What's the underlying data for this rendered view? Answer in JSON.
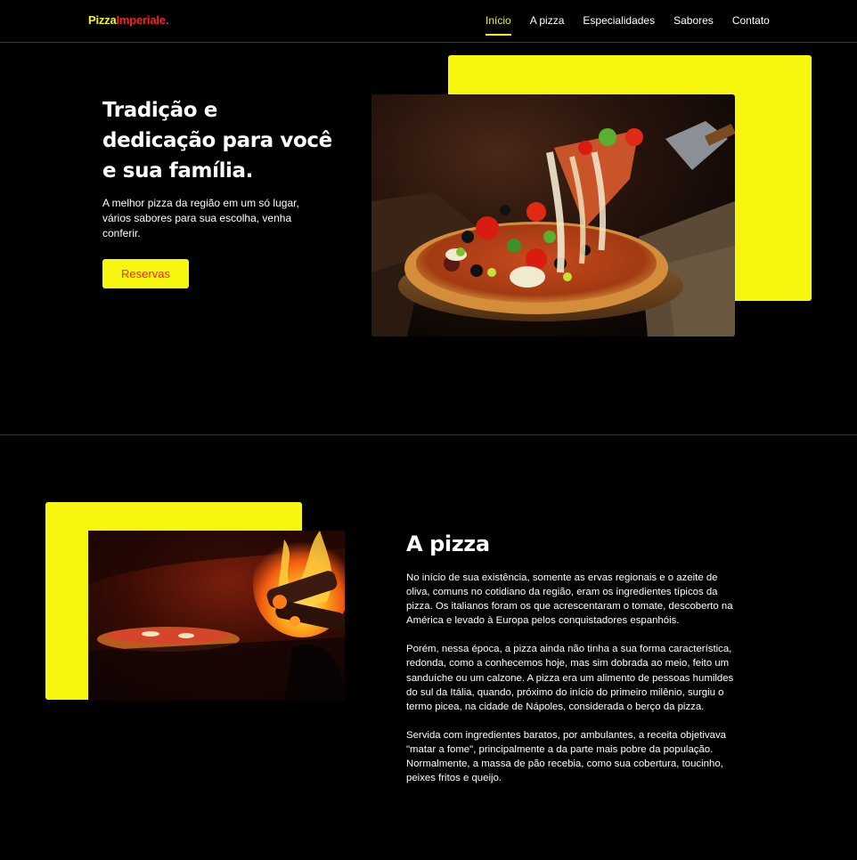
{
  "brand": {
    "part1": "Pizza",
    "part2": "Imperiale",
    "part3": "."
  },
  "nav": [
    {
      "label": "Início",
      "active": true
    },
    {
      "label": "A pizza"
    },
    {
      "label": "Especialidades"
    },
    {
      "label": "Sabores"
    },
    {
      "label": "Contato"
    }
  ],
  "hero": {
    "title": "Tradição e dedicação para você e sua família.",
    "subtitle": "A melhor pizza da região em um só lugar, vários sabores para sua escolha, venha conferir.",
    "button": "Reservas"
  },
  "about": {
    "title": "A pizza",
    "paragraphs": [
      "No início de sua existência, somente as ervas regionais e o azeite de oliva, comuns no cotidiano da região, eram os ingredientes típicos da pizza. Os italianos foram os que acrescentaram o tomate, descoberto na América e levado à Europa pelos conquistadores espanhóis.",
      "Porém, nessa época, a pizza ainda não tinha a sua forma característica, redonda, como a conhecemos hoje, mas sim dobrada ao meio, feito um sanduíche ou um calzone. A pizza era um alimento de pessoas humildes do sul da Itália, quando, próximo do início do primeiro milênio, surgiu o termo picea, na cidade de Nápoles, considerada o berço da pizza.",
      "Servida com ingredientes baratos, por ambulantes, a receita objetivava \"matar a fome\", principalmente a da parte mais pobre da população. Normalmente, a massa de pão recebia, como sua cobertura, toucinho, peixes fritos e queijo."
    ]
  },
  "colors": {
    "accent": "#f6f60f",
    "brand_red": "#ff1f1f",
    "background": "#000000"
  }
}
